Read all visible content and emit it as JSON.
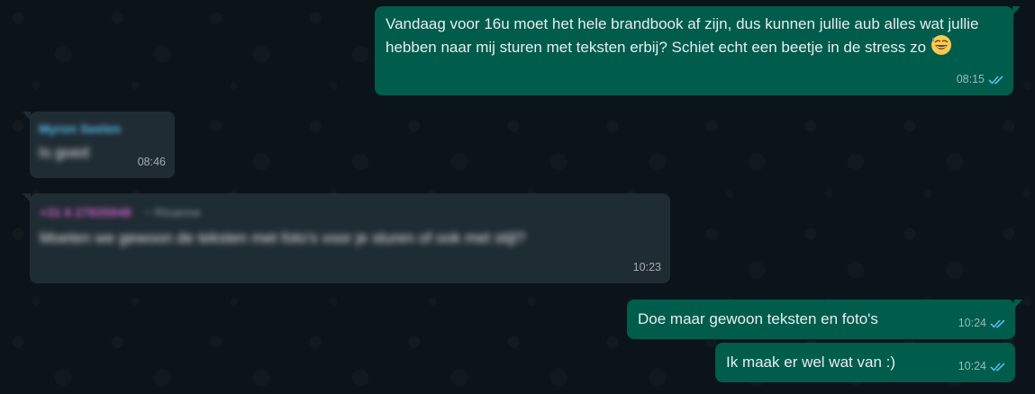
{
  "colors": {
    "background": "#0b141a",
    "outgoing_bubble": "#005c4b",
    "incoming_bubble": "#202c33",
    "text": "#e9edef",
    "read_ticks": "#53bdeb",
    "sender_blue": "#53bdeb",
    "sender_pink": "#c95ec4"
  },
  "messages": [
    {
      "direction": "outgoing",
      "text": "Vandaag voor 16u moet het hele brandbook af zijn, dus kunnen jullie aub alles wat jullie hebben naar mij sturen met teksten erbij? Schiet echt een beetje in de stress zo",
      "emoji": "grinning-face-with-sweat",
      "time": "08:15",
      "status_icon": "double-check-read-icon"
    },
    {
      "direction": "incoming",
      "sender": "Myron Seelen",
      "text": "Is goed",
      "time": "08:46"
    },
    {
      "direction": "incoming",
      "sender": "+31 6 27835948",
      "sender_subtitle": "~ Rixanne",
      "text": "Moeten we gewoon de teksten met foto's voor je sturen of ook met stijl?",
      "time": "10:23"
    },
    {
      "direction": "outgoing",
      "text": "Doe maar gewoon teksten en foto's",
      "time": "10:24",
      "status_icon": "double-check-read-icon"
    },
    {
      "direction": "outgoing",
      "text": "Ik maak er wel wat van :)",
      "time": "10:24",
      "status_icon": "double-check-read-icon"
    }
  ]
}
